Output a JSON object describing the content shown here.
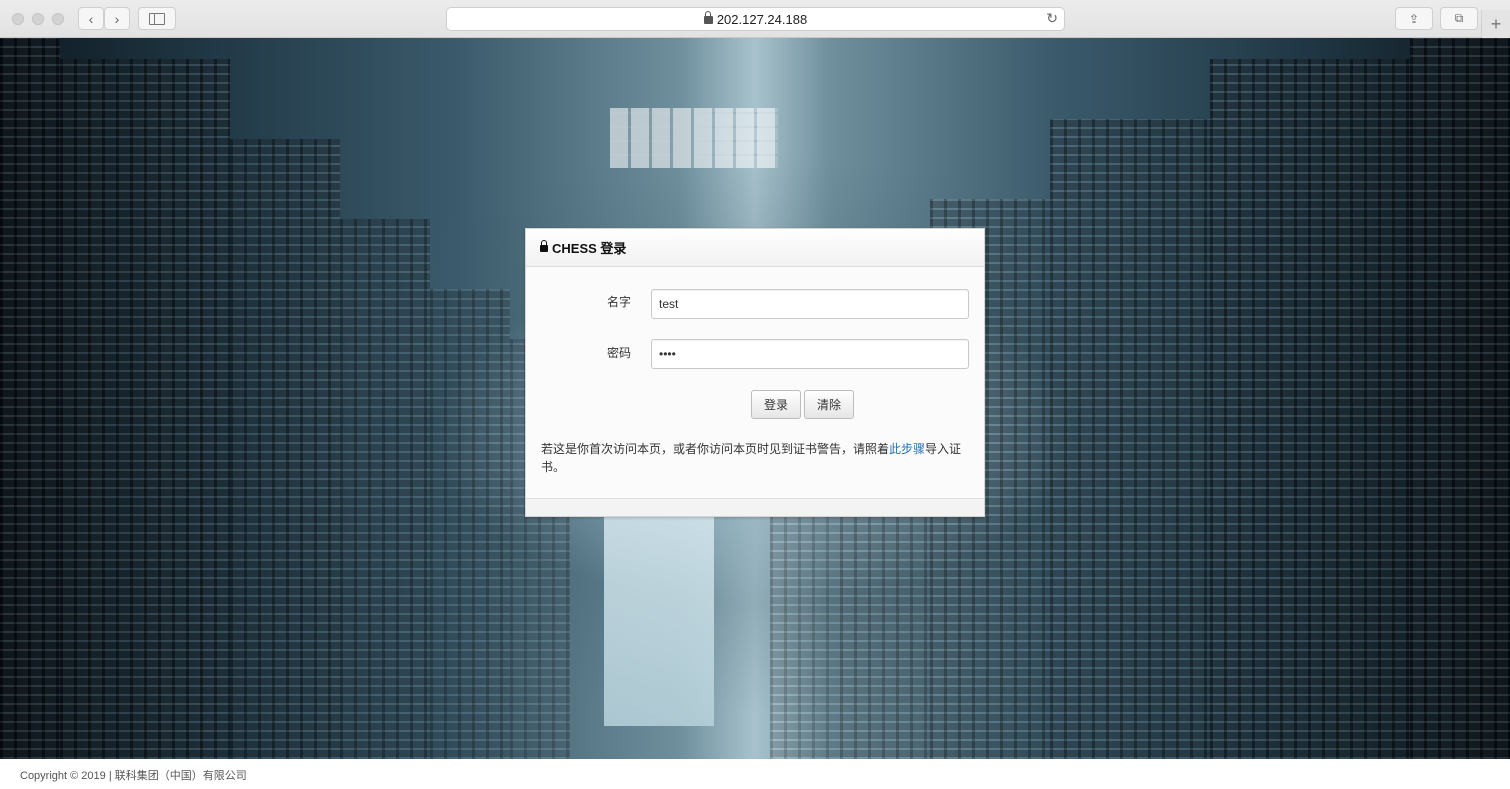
{
  "browser": {
    "url": "202.127.24.188"
  },
  "login": {
    "title": "CHESS 登录",
    "name_label": "名字",
    "name_value": "test",
    "password_label": "密码",
    "password_value": "••••",
    "login_button": "登录",
    "clear_button": "清除",
    "note_before": "若这是你首次访问本页，或者你访问本页时见到证书警告，请照着",
    "note_link": "此步骤",
    "note_after": "导入证书。"
  },
  "footer": {
    "copyright": "Copyright © 2019 | 联科集团（中国）有限公司"
  }
}
